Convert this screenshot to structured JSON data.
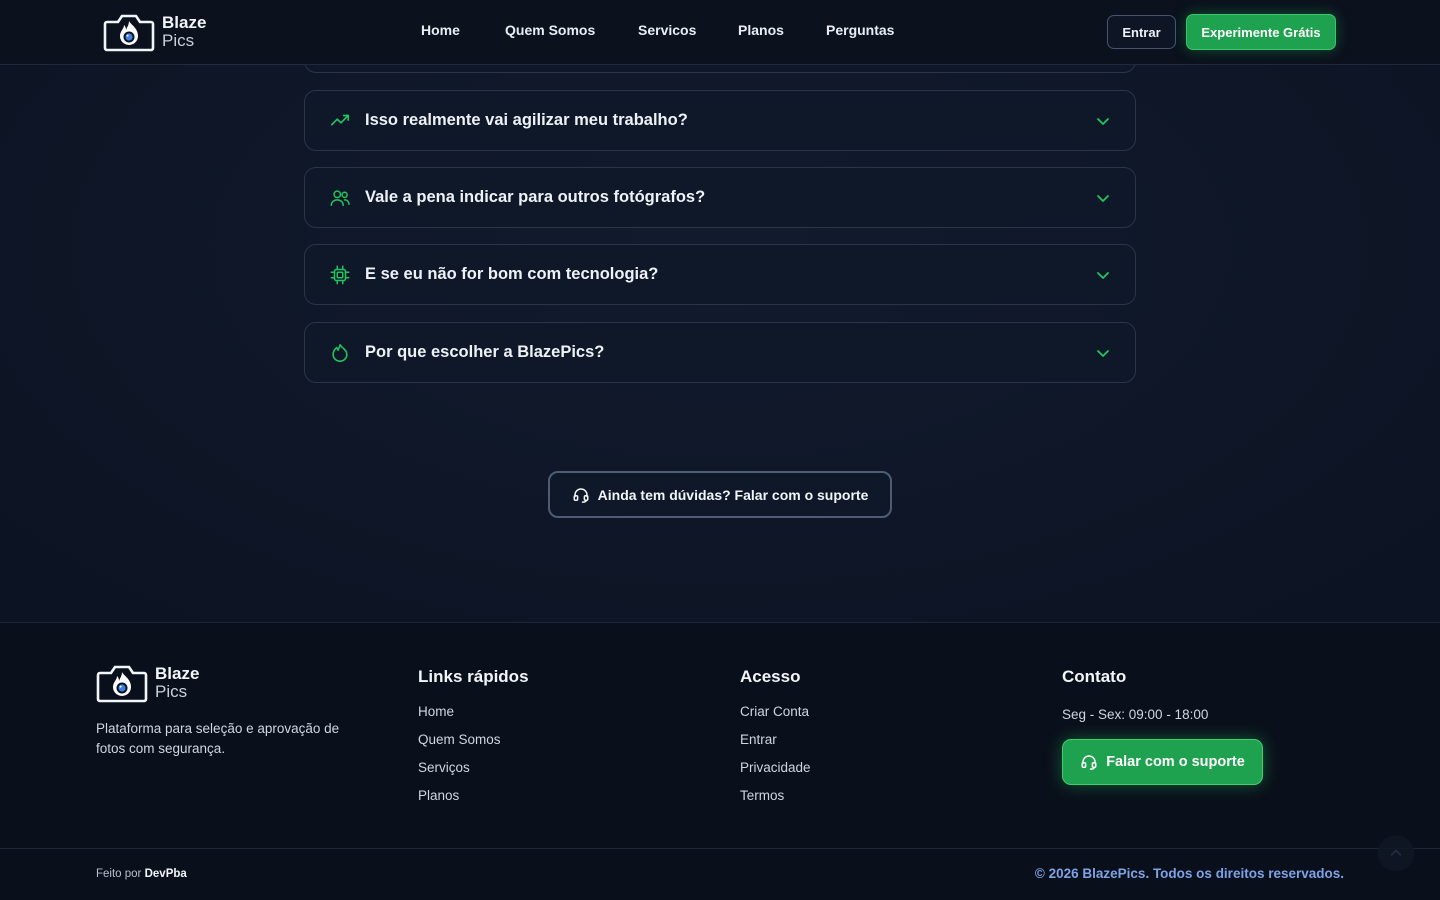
{
  "brand": {
    "line1": "Blaze",
    "line2": "Pics"
  },
  "nav": {
    "items": [
      {
        "label": "Home"
      },
      {
        "label": "Quem Somos"
      },
      {
        "label": "Servicos"
      },
      {
        "label": "Planos"
      },
      {
        "label": "Perguntas"
      }
    ],
    "login_label": "Entrar",
    "trial_label": "Experimente Grátis"
  },
  "faq": {
    "items": [
      {
        "icon": "trending-up-icon",
        "question": "Isso realmente vai agilizar meu trabalho?"
      },
      {
        "icon": "users-icon",
        "question": "Vale a pena indicar para outros fotógrafos?"
      },
      {
        "icon": "cpu-chip-icon",
        "question": "E se eu não for bom com tecnologia?"
      },
      {
        "icon": "flame-icon",
        "question": "Por que escolher a BlazePics?"
      }
    ],
    "support_cta": "Ainda tem dúvidas? Falar com o suporte"
  },
  "footer": {
    "description": "Plataforma para seleção e aprovação de fotos com segurança.",
    "quick_links": {
      "title": "Links rápidos",
      "items": [
        "Home",
        "Quem Somos",
        "Serviços",
        "Planos"
      ]
    },
    "access": {
      "title": "Acesso",
      "items": [
        "Criar Conta",
        "Entrar",
        "Privacidade",
        "Termos"
      ]
    },
    "contact": {
      "title": "Contato",
      "hours": "Seg - Sex: 09:00 - 18:00",
      "support_label": "Falar com o suporte"
    },
    "made_by_prefix": "Feito por",
    "made_by_name": "DevPba",
    "copyright": "© 2026 BlazePics. Todos os direitos reservados."
  },
  "colors": {
    "accent_green": "#22c55e",
    "copyright_blue": "#7ea2e6",
    "background": "#0d1525"
  }
}
